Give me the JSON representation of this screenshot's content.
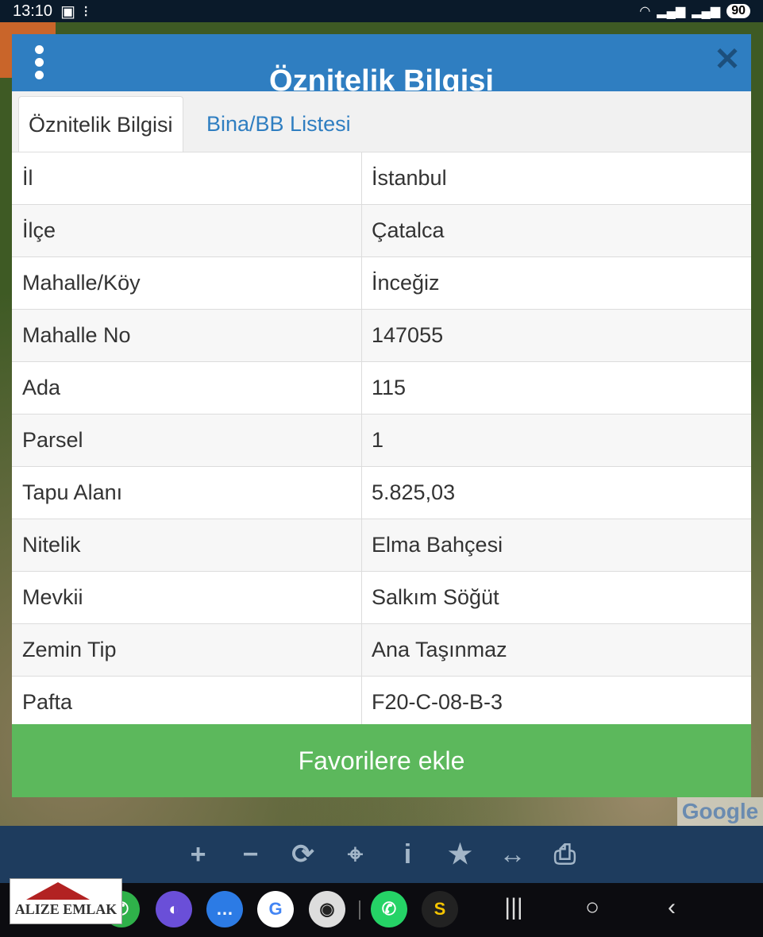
{
  "status_bar": {
    "time": "13:10",
    "battery": "90"
  },
  "dialog": {
    "title": "Öznitelik Bilgisi",
    "close_icon": "close-icon",
    "tabs": [
      {
        "label": "Öznitelik Bilgisi",
        "active": true
      },
      {
        "label": "Bina/BB Listesi",
        "active": false
      }
    ],
    "rows": [
      {
        "key": "İl",
        "value": "İstanbul"
      },
      {
        "key": "İlçe",
        "value": "Çatalca"
      },
      {
        "key": "Mahalle/Köy",
        "value": "İnceğiz"
      },
      {
        "key": "Mahalle No",
        "value": "147055"
      },
      {
        "key": "Ada",
        "value": "115"
      },
      {
        "key": "Parsel",
        "value": "1"
      },
      {
        "key": "Tapu Alanı",
        "value": "5.825,03"
      },
      {
        "key": "Nitelik",
        "value": "Elma Bahçesi"
      },
      {
        "key": "Mevkii",
        "value": "Salkım Söğüt"
      },
      {
        "key": "Zemin Tip",
        "value": "Ana Taşınmaz"
      },
      {
        "key": "Pafta",
        "value": "F20-C-08-B-3"
      }
    ],
    "favorite_button": "Favorilere ekle"
  },
  "map": {
    "attribution": "Google"
  },
  "toolbar": {
    "icons": [
      "zoom-in-icon",
      "zoom-out-icon",
      "refresh-icon",
      "locate-icon",
      "info-icon",
      "star-icon",
      "measure-icon",
      "print-icon"
    ]
  },
  "watermark_logo": "ALIZE EMLAK",
  "colors": {
    "header": "#2f7ec1",
    "favorite": "#5cb85c",
    "toolbar": "#1e3c5e"
  }
}
